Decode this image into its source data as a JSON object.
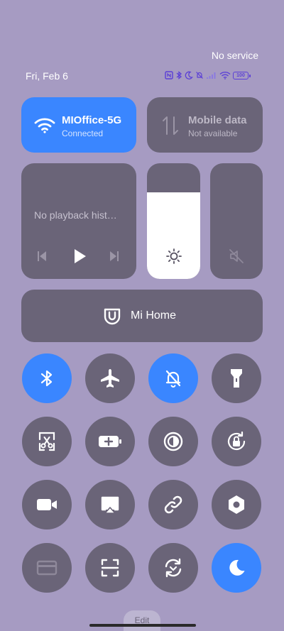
{
  "status": {
    "carrier": "No service",
    "date": "Fri, Feb 6",
    "battery": "100"
  },
  "wifi": {
    "name": "MIOffice-5G",
    "status": "Connected"
  },
  "mobile": {
    "title": "Mobile data",
    "status": "Not available"
  },
  "media": {
    "text": "No playback hist…"
  },
  "brightness": {
    "level": 0.75
  },
  "volume": {
    "level": 0.0
  },
  "mihome": {
    "label": "Mi Home"
  },
  "toggles": [
    {
      "name": "bluetooth-icon",
      "active": true
    },
    {
      "name": "airplane-icon",
      "active": false
    },
    {
      "name": "silent-icon",
      "active": true
    },
    {
      "name": "flashlight-icon",
      "active": false
    },
    {
      "name": "screenshot-icon",
      "active": false
    },
    {
      "name": "battery-saver-icon",
      "active": false
    },
    {
      "name": "reading-mode-icon",
      "active": false
    },
    {
      "name": "rotation-lock-icon",
      "active": false
    },
    {
      "name": "video-icon",
      "active": false
    },
    {
      "name": "cast-icon",
      "active": false
    },
    {
      "name": "link-icon",
      "active": false
    },
    {
      "name": "settings-nut-icon",
      "active": false
    },
    {
      "name": "card-icon",
      "active": false
    },
    {
      "name": "scanner-icon",
      "active": false
    },
    {
      "name": "sync-icon",
      "active": false
    },
    {
      "name": "dark-mode-icon",
      "active": true
    }
  ],
  "edit": {
    "label": "Edit"
  },
  "colors": {
    "accent": "#3a86ff",
    "tile": "#6a6478",
    "background": "#a69bc2"
  }
}
